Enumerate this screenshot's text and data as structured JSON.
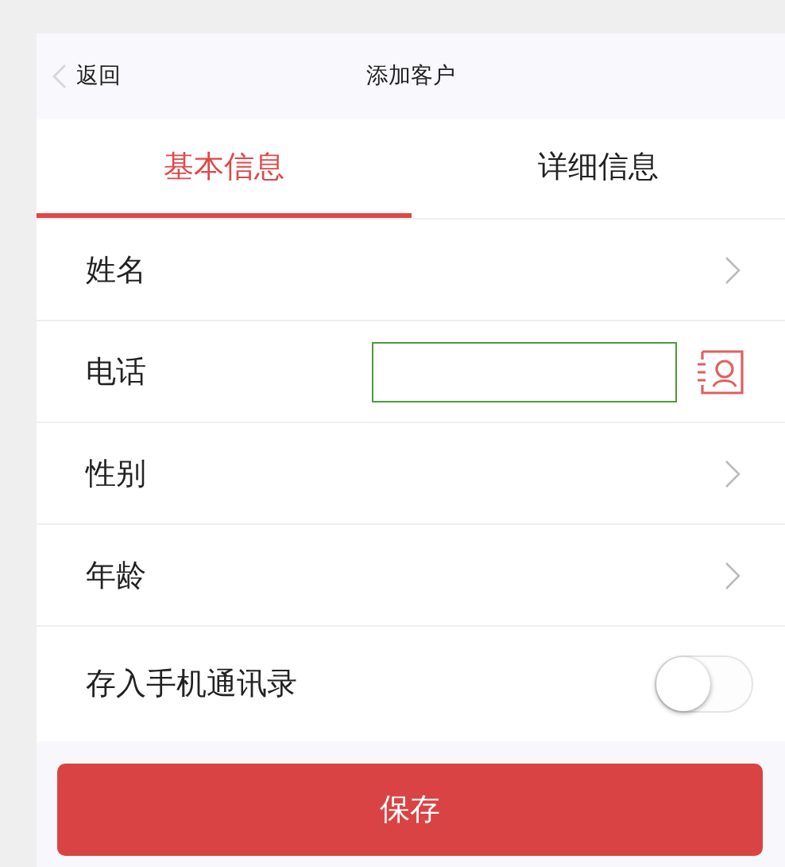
{
  "header": {
    "back": "返回",
    "title": "添加客户"
  },
  "tabs": [
    {
      "label": "基本信息",
      "selected": true
    },
    {
      "label": "详细信息",
      "selected": false
    }
  ],
  "rows": [
    {
      "kind": "arrow",
      "label": "姓名"
    },
    {
      "kind": "input",
      "label": "电话"
    },
    {
      "kind": "arrow",
      "label": "性别"
    },
    {
      "kind": "arrow",
      "label": "年龄"
    },
    {
      "kind": "toggle",
      "label": "存入手机通讯录",
      "on": false
    }
  ],
  "save_button": "保存"
}
